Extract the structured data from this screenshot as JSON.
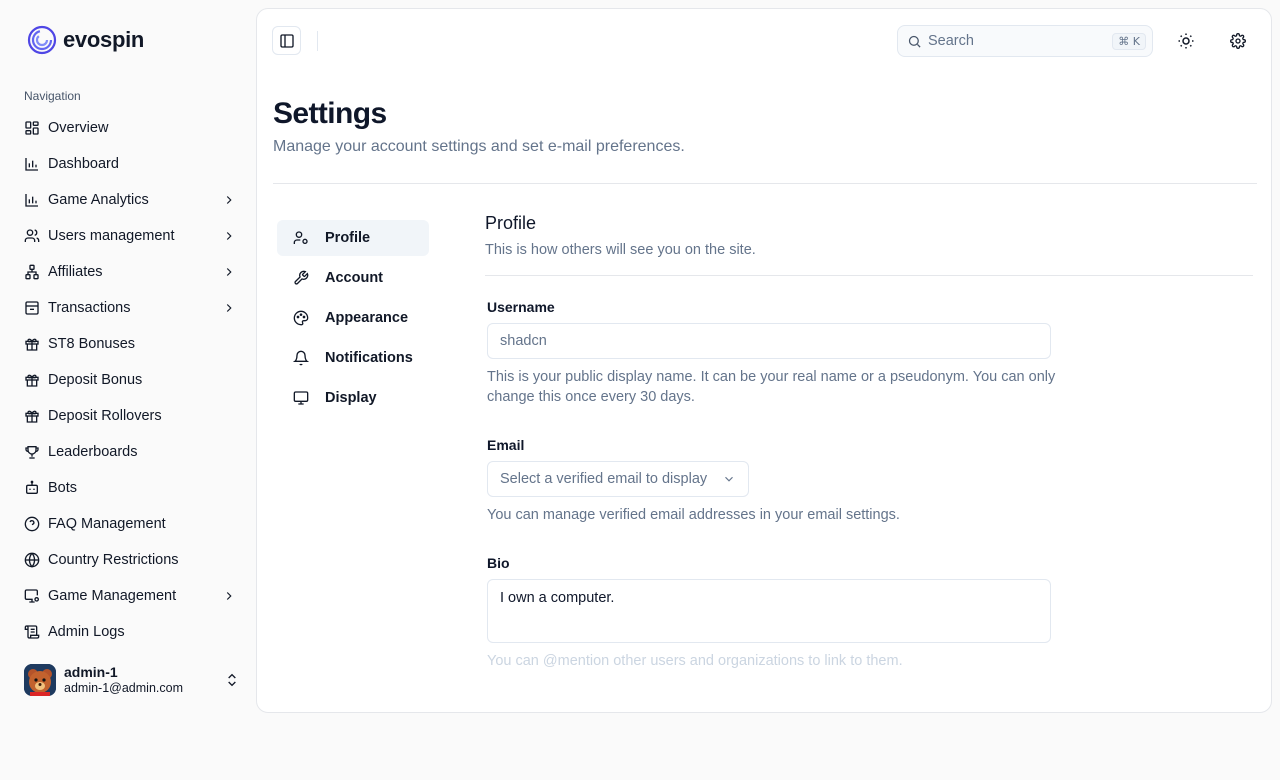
{
  "brand": {
    "name": "evospin"
  },
  "sidebar": {
    "section_label": "Navigation",
    "items": [
      {
        "label": "Overview",
        "icon": "layout-grid-icon",
        "chevron": false
      },
      {
        "label": "Dashboard",
        "icon": "bar-chart-icon",
        "chevron": false
      },
      {
        "label": "Game Analytics",
        "icon": "bar-chart-icon",
        "chevron": true
      },
      {
        "label": "Users management",
        "icon": "users-icon",
        "chevron": true
      },
      {
        "label": "Affiliates",
        "icon": "network-icon",
        "chevron": true
      },
      {
        "label": "Transactions",
        "icon": "archive-icon",
        "chevron": true
      },
      {
        "label": "ST8 Bonuses",
        "icon": "gift-icon",
        "chevron": false
      },
      {
        "label": "Deposit Bonus",
        "icon": "gift-icon",
        "chevron": false
      },
      {
        "label": "Deposit Rollovers",
        "icon": "gift-icon",
        "chevron": false
      },
      {
        "label": "Leaderboards",
        "icon": "trophy-icon",
        "chevron": false
      },
      {
        "label": "Bots",
        "icon": "bot-icon",
        "chevron": false
      },
      {
        "label": "FAQ Management",
        "icon": "help-circle-icon",
        "chevron": false
      },
      {
        "label": "Country Restrictions",
        "icon": "globe-icon",
        "chevron": false
      },
      {
        "label": "Game Management",
        "icon": "monitor-cog-icon",
        "chevron": true
      },
      {
        "label": "Admin Logs",
        "icon": "scroll-icon",
        "chevron": false
      }
    ],
    "user": {
      "name": "admin-1",
      "email": "admin-1@admin.com"
    }
  },
  "header": {
    "search_placeholder": "Search",
    "search_shortcut": "⌘ K"
  },
  "page": {
    "title": "Settings",
    "subtitle": "Manage your account settings and set e-mail preferences."
  },
  "settings_nav": [
    {
      "label": "Profile",
      "icon": "user-cog-icon",
      "active": true
    },
    {
      "label": "Account",
      "icon": "wrench-icon",
      "active": false
    },
    {
      "label": "Appearance",
      "icon": "palette-icon",
      "active": false
    },
    {
      "label": "Notifications",
      "icon": "bell-icon",
      "active": false
    },
    {
      "label": "Display",
      "icon": "monitor-icon",
      "active": false
    }
  ],
  "profile": {
    "title": "Profile",
    "subtitle": "This is how others will see you on the site.",
    "username": {
      "label": "Username",
      "placeholder": "shadcn",
      "helper": "This is your public display name. It can be your real name or a pseudonym. You can only change this once every 30 days."
    },
    "email": {
      "label": "Email",
      "placeholder": "Select a verified email to display",
      "helper": "You can manage verified email addresses in your email settings."
    },
    "bio": {
      "label": "Bio",
      "value": "I own a computer.",
      "helper": "You can @mention other users and organizations to link to them."
    }
  }
}
